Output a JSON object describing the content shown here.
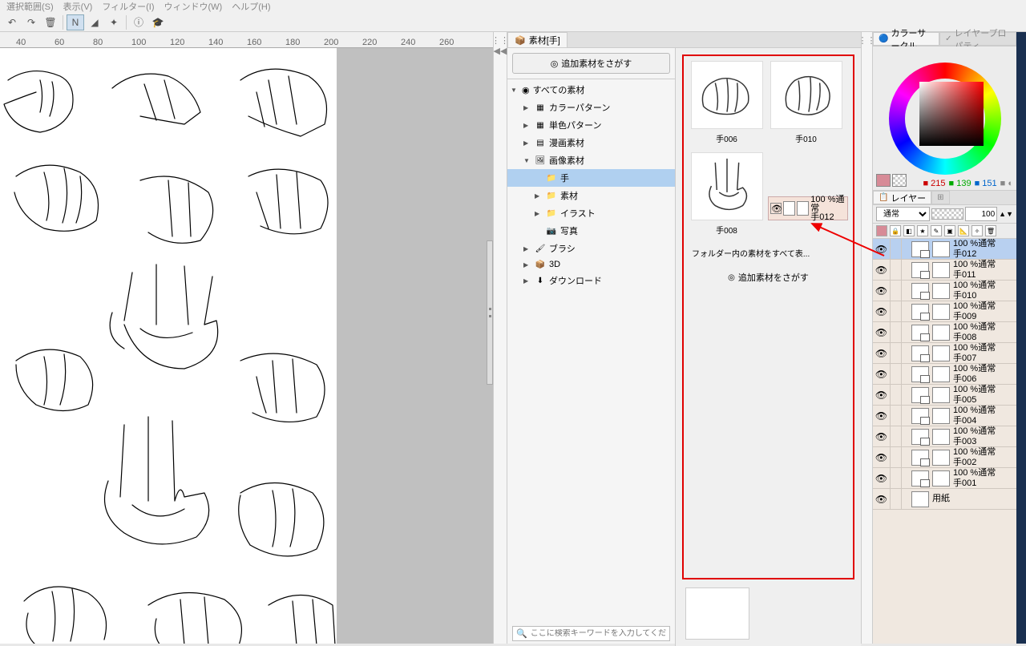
{
  "menubar": [
    "選択範囲(S)",
    "表示(V)",
    "フィルター(I)",
    "ウィンドウ(W)",
    "ヘルプ(H)"
  ],
  "ruler_marks": [
    40,
    60,
    80,
    100,
    120,
    140,
    160,
    180,
    200,
    220,
    240,
    260
  ],
  "material": {
    "tab": "素材[手]",
    "search_more": "追加素材をさがす",
    "tree": {
      "root": "すべての素材",
      "items": [
        {
          "label": "カラーパターン",
          "icon": "grid",
          "indent": 1,
          "arrow": "▶"
        },
        {
          "label": "単色パターン",
          "icon": "grid",
          "indent": 1,
          "arrow": "▶"
        },
        {
          "label": "漫画素材",
          "icon": "book",
          "indent": 1,
          "arrow": "▶"
        },
        {
          "label": "画像素材",
          "icon": "image",
          "indent": 1,
          "arrow": "▼"
        },
        {
          "label": "手",
          "icon": "folder",
          "indent": 2,
          "selected": true
        },
        {
          "label": "素材",
          "icon": "folder",
          "indent": 2,
          "arrow": "▶"
        },
        {
          "label": "イラスト",
          "icon": "folder",
          "indent": 2,
          "arrow": "▶"
        },
        {
          "label": "写真",
          "icon": "camera",
          "indent": 2
        },
        {
          "label": "ブラシ",
          "icon": "brush",
          "indent": 1,
          "arrow": "▶"
        },
        {
          "label": "3D",
          "icon": "3d",
          "indent": 1,
          "arrow": "▶"
        },
        {
          "label": "ダウンロード",
          "icon": "download",
          "indent": 1,
          "arrow": "▶"
        }
      ]
    },
    "search_placeholder": "ここに検索キーワードを入力してください",
    "thumbs": [
      {
        "label": "手006"
      },
      {
        "label": "手010"
      },
      {
        "label": "手008"
      }
    ],
    "note": "フォルダー内の素材をすべて表...",
    "ghost": {
      "opacity": "100 %通常",
      "name": "手012"
    }
  },
  "color": {
    "tab1": "カラーサークル",
    "tab2": "レイヤープロパティ",
    "r": 215,
    "g": 139,
    "b": 151,
    "swatch_hex": "#d78b97"
  },
  "layers": {
    "tab": "レイヤー",
    "blend": "通常",
    "opacity": 100,
    "items": [
      {
        "opacity": "100 %通常",
        "name": "手012",
        "selected": true
      },
      {
        "opacity": "100 %通常",
        "name": "手011"
      },
      {
        "opacity": "100 %通常",
        "name": "手010"
      },
      {
        "opacity": "100 %通常",
        "name": "手009"
      },
      {
        "opacity": "100 %通常",
        "name": "手008"
      },
      {
        "opacity": "100 %通常",
        "name": "手007"
      },
      {
        "opacity": "100 %通常",
        "name": "手006"
      },
      {
        "opacity": "100 %通常",
        "name": "手005"
      },
      {
        "opacity": "100 %通常",
        "name": "手004"
      },
      {
        "opacity": "100 %通常",
        "name": "手003"
      },
      {
        "opacity": "100 %通常",
        "name": "手002"
      },
      {
        "opacity": "100 %通常",
        "name": "手001"
      },
      {
        "opacity": "",
        "name": "用紙",
        "paper": true
      }
    ]
  }
}
